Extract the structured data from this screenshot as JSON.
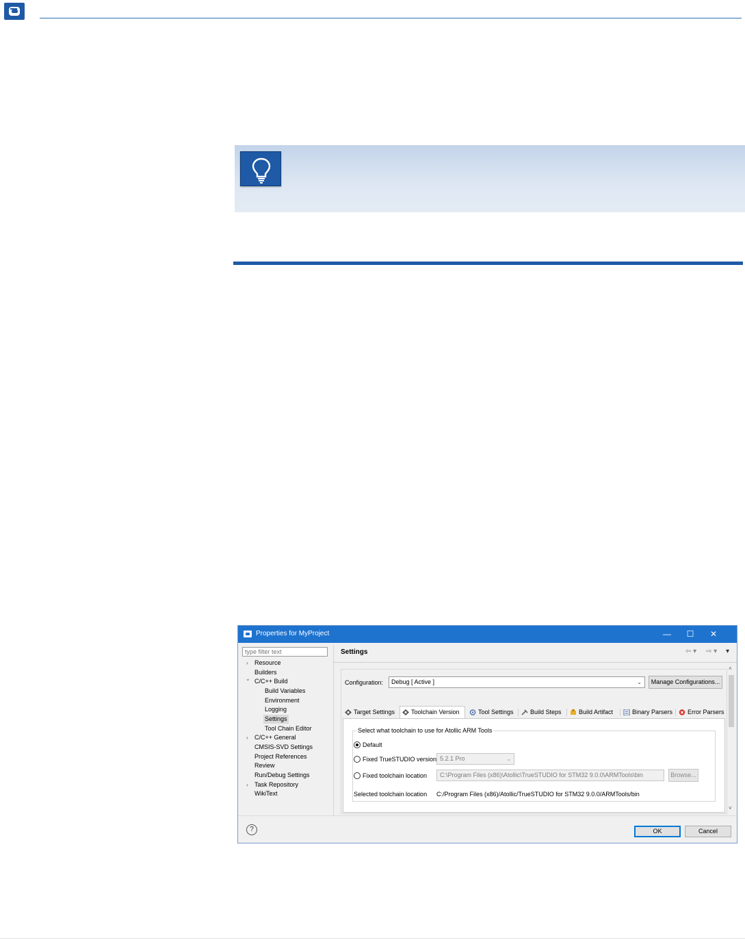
{
  "dialog": {
    "title": "Properties for MyProject",
    "window_controls": {
      "minimize": "—",
      "maximize": "☐",
      "close": "✕"
    },
    "filter_placeholder": "type filter text",
    "tree": [
      {
        "label": "Resource",
        "expander": "›"
      },
      {
        "label": "Builders"
      },
      {
        "label": "C/C++ Build",
        "expander": "⌄"
      },
      {
        "label": "Build Variables"
      },
      {
        "label": "Environment"
      },
      {
        "label": "Logging"
      },
      {
        "label": "Settings",
        "selected": true
      },
      {
        "label": "Tool Chain Editor"
      },
      {
        "label": "C/C++ General",
        "expander": "›"
      },
      {
        "label": "CMSIS-SVD Settings"
      },
      {
        "label": "Project References"
      },
      {
        "label": "Review"
      },
      {
        "label": "Run/Debug Settings"
      },
      {
        "label": "Task Repository",
        "expander": "›"
      },
      {
        "label": "WikiText"
      }
    ],
    "page_title": "Settings",
    "nav": {
      "back": "⇦ ▾",
      "forward": "⇨ ▾",
      "menu": "▾"
    },
    "scroll": {
      "up": "˄",
      "down": "˅"
    },
    "configuration": {
      "label": "Configuration:",
      "value": "Debug  [ Active ]",
      "caret": "⌄",
      "manage_button": "Manage Configurations..."
    },
    "tabs": [
      {
        "label": "Target Settings",
        "icon": "gear-icon"
      },
      {
        "label": "Toolchain Version",
        "icon": "gear-icon",
        "active": true
      },
      {
        "label": "Tool Settings",
        "icon": "tool-settings-icon"
      },
      {
        "label": "Build Steps",
        "icon": "wrench-icon"
      },
      {
        "label": "Build Artifact",
        "icon": "artifact-icon"
      },
      {
        "label": "Binary Parsers",
        "icon": "binary-parser-icon"
      },
      {
        "label": "Error Parsers",
        "icon": "error-icon"
      }
    ],
    "toolchain": {
      "group_label": "Select what toolchain to use for Atollic ARM Tools",
      "default_label": "Default",
      "fixed_version_label": "Fixed TrueSTUDIO version",
      "fixed_version_value": "5.2.1 Pro",
      "fixed_location_label": "Fixed toolchain location",
      "fixed_location_value": "C:\\Program Files (x86)\\Atollic\\TrueSTUDIO for STM32 9.0.0\\ARMTools\\bin",
      "browse_label": "Browse...",
      "selected_label": "Selected toolchain location",
      "selected_value": "C:/Program Files (x86)/Atollic/TrueSTUDIO for STM32 9.0.0/ARMTools/bin"
    },
    "help_glyph": "?",
    "ok_label": "OK",
    "cancel_label": "Cancel"
  },
  "colors": {
    "brand_blue": "#1f5aa6",
    "titlebar_blue": "#1e73cf",
    "tip_gradient_top": "#c3d4ea"
  }
}
